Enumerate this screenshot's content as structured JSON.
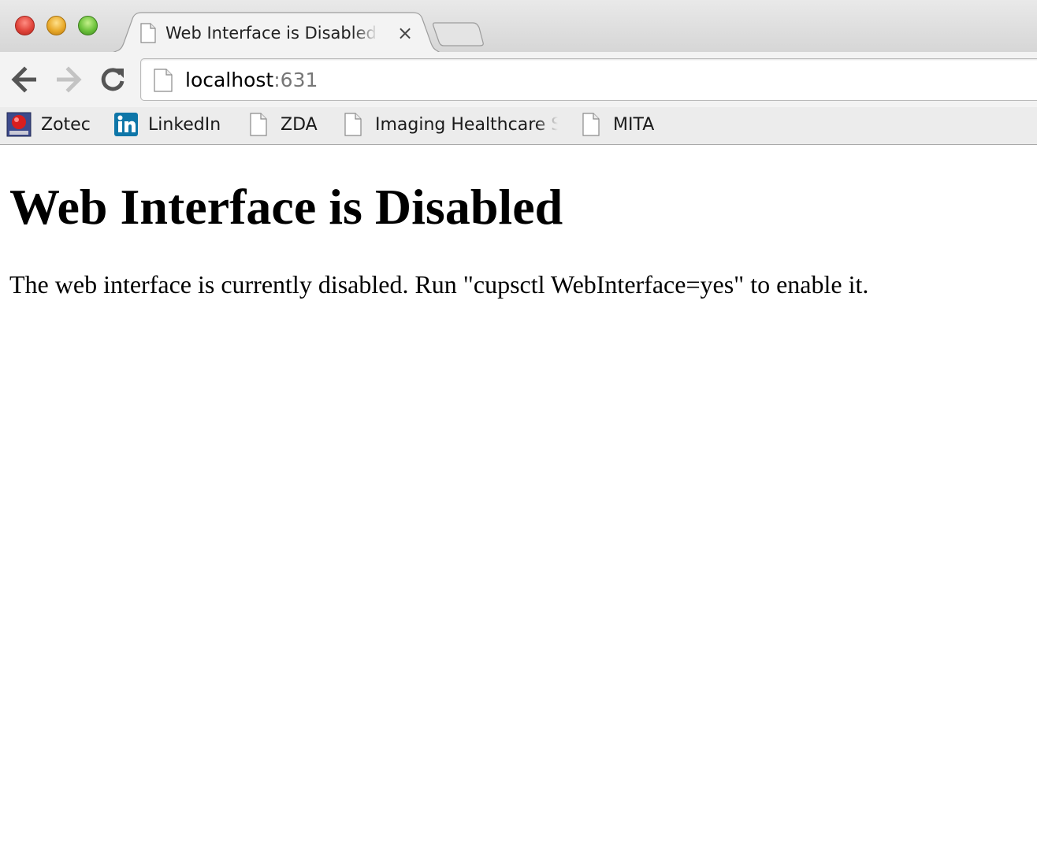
{
  "window": {
    "traffic_lights": [
      "close",
      "minimize",
      "zoom"
    ]
  },
  "tab": {
    "title": "Web Interface is Disabled - CUPS",
    "icon": "page-icon",
    "close_glyph": "×"
  },
  "toolbar": {
    "back_icon": "back-arrow-icon",
    "forward_icon": "forward-arrow-icon",
    "reload_icon": "reload-icon",
    "address": {
      "host": "localhost",
      "port": ":631"
    }
  },
  "bookmarks": [
    {
      "label": "Zotec",
      "icon": "zotec-favicon-icon"
    },
    {
      "label": "LinkedIn",
      "icon": "linkedin-icon"
    },
    {
      "label": "ZDA",
      "icon": "page-icon"
    },
    {
      "label": "Imaging Healthcare Specialists",
      "icon": "page-icon"
    },
    {
      "label": "MITA",
      "icon": "page-icon"
    }
  ],
  "page": {
    "heading": "Web Interface is Disabled",
    "message": "The web interface is currently disabled. Run \"cupsctl WebInterface=yes\" to enable it."
  },
  "colors": {
    "linkedin_blue": "#0e76a8",
    "close_red": "#e0443a",
    "minimize_yellow": "#e8a92a",
    "zoom_green": "#6cc23b"
  }
}
